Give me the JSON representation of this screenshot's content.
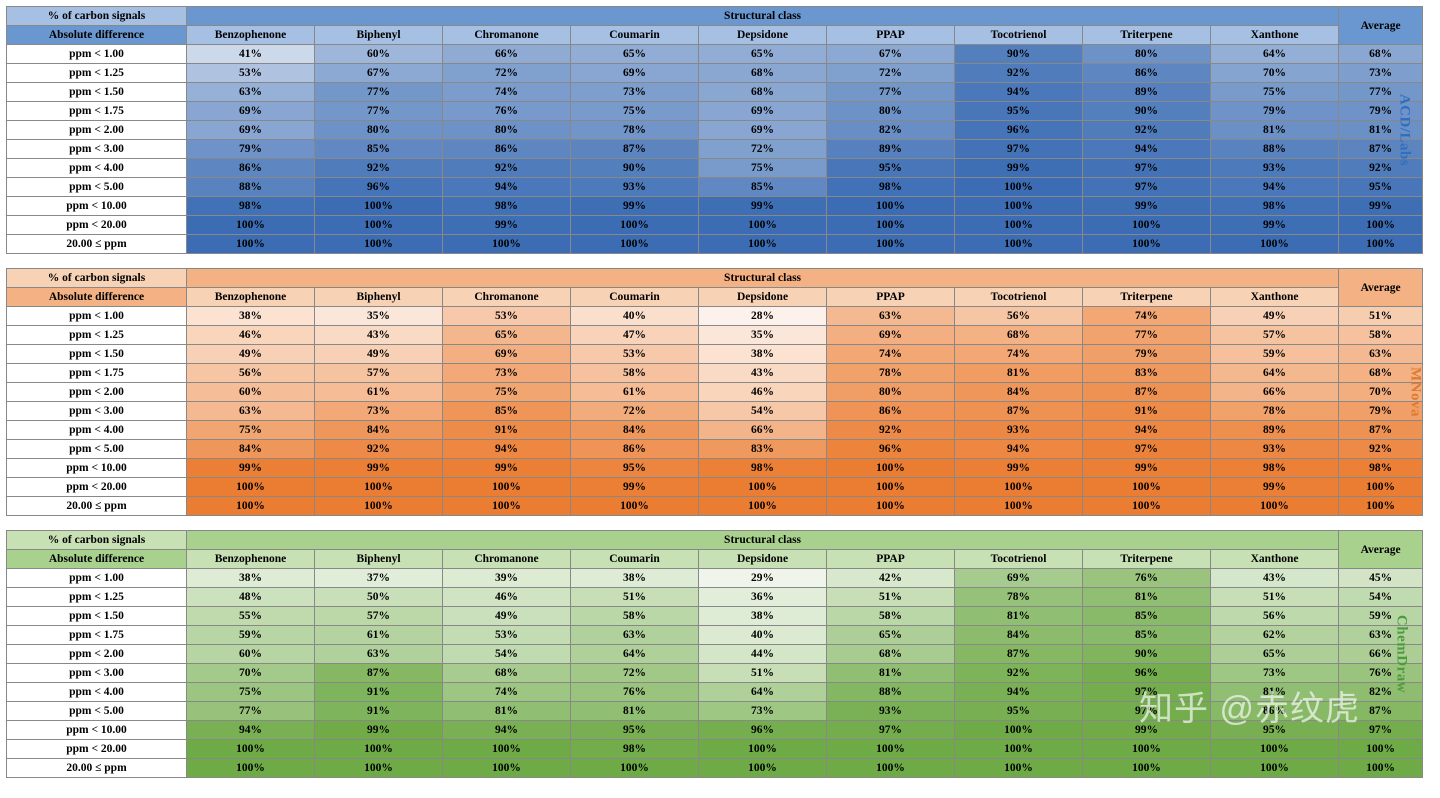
{
  "columns": [
    "Benzophenone",
    "Biphenyl",
    "Chromanone",
    "Coumarin",
    "Depsidone",
    "PPAP",
    "Tocotrienol",
    "Triterpene",
    "Xanthone"
  ],
  "row_labels": [
    "ppm < 1.00",
    "ppm < 1.25",
    "ppm < 1.50",
    "ppm < 1.75",
    "ppm < 2.00",
    "ppm < 3.00",
    "ppm < 4.00",
    "ppm < 5.00",
    "ppm < 10.00",
    "ppm < 20.00",
    "20.00 ≤ ppm"
  ],
  "header_labels": {
    "left_top": "% of carbon signals",
    "left_bottom": "Absolute difference",
    "center": "Structural class",
    "right": "Average"
  },
  "side_labels": [
    "ACD/Labs",
    "MNova",
    "ChemDraw"
  ],
  "watermark": "知乎 @赤纹虎",
  "schemes": [
    {
      "header_bg": [
        "#6a97cf",
        "#a6c0e4",
        "#6a97cf"
      ],
      "base_rgb": [
        60,
        109,
        180
      ],
      "side_class": "side-blue"
    },
    {
      "header_bg": [
        "#f4b183",
        "#f8d2b4",
        "#f4b183"
      ],
      "base_rgb": [
        235,
        125,
        50
      ],
      "side_class": "side-orange"
    },
    {
      "header_bg": [
        "#a9d18e",
        "#c7e0b4",
        "#a9d18e"
      ],
      "base_rgb": [
        110,
        170,
        70
      ],
      "side_class": "side-green"
    }
  ],
  "chart_data": [
    {
      "type": "table",
      "title": "ACD/Labs — % of carbon signals within absolute-difference threshold",
      "row_labels_ref": "row_labels",
      "columns_ref": "columns",
      "average_column": true,
      "unit": "%",
      "values": [
        [
          41,
          60,
          66,
          65,
          65,
          67,
          90,
          80,
          64,
          68
        ],
        [
          53,
          67,
          72,
          69,
          68,
          72,
          92,
          86,
          70,
          73
        ],
        [
          63,
          77,
          74,
          73,
          68,
          77,
          94,
          89,
          75,
          77
        ],
        [
          69,
          77,
          76,
          75,
          69,
          80,
          95,
          90,
          79,
          79
        ],
        [
          69,
          80,
          80,
          78,
          69,
          82,
          96,
          92,
          81,
          81
        ],
        [
          79,
          85,
          86,
          87,
          72,
          89,
          97,
          94,
          88,
          87
        ],
        [
          86,
          92,
          92,
          90,
          75,
          95,
          99,
          97,
          93,
          92
        ],
        [
          88,
          96,
          94,
          93,
          85,
          98,
          100,
          97,
          94,
          95
        ],
        [
          98,
          100,
          98,
          99,
          99,
          100,
          100,
          99,
          98,
          99
        ],
        [
          100,
          100,
          99,
          100,
          100,
          100,
          100,
          100,
          99,
          100
        ],
        [
          100,
          100,
          100,
          100,
          100,
          100,
          100,
          100,
          100,
          100
        ]
      ]
    },
    {
      "type": "table",
      "title": "MNova — % of carbon signals within absolute-difference threshold",
      "row_labels_ref": "row_labels",
      "columns_ref": "columns",
      "average_column": true,
      "unit": "%",
      "values": [
        [
          38,
          35,
          53,
          40,
          28,
          63,
          56,
          74,
          49,
          51
        ],
        [
          46,
          43,
          65,
          47,
          35,
          69,
          68,
          77,
          57,
          58
        ],
        [
          49,
          49,
          69,
          53,
          38,
          74,
          74,
          79,
          59,
          63
        ],
        [
          56,
          57,
          73,
          58,
          43,
          78,
          81,
          83,
          64,
          68
        ],
        [
          60,
          61,
          75,
          61,
          46,
          80,
          84,
          87,
          66,
          70
        ],
        [
          63,
          73,
          85,
          72,
          54,
          86,
          87,
          91,
          78,
          79
        ],
        [
          75,
          84,
          91,
          84,
          66,
          92,
          93,
          94,
          89,
          87
        ],
        [
          84,
          92,
          94,
          86,
          83,
          96,
          94,
          97,
          93,
          92
        ],
        [
          99,
          99,
          99,
          95,
          98,
          100,
          99,
          99,
          98,
          98
        ],
        [
          100,
          100,
          100,
          99,
          100,
          100,
          100,
          100,
          99,
          100
        ],
        [
          100,
          100,
          100,
          100,
          100,
          100,
          100,
          100,
          100,
          100
        ]
      ]
    },
    {
      "type": "table",
      "title": "ChemDraw — % of carbon signals within absolute-difference threshold",
      "row_labels_ref": "row_labels",
      "columns_ref": "columns",
      "average_column": true,
      "unit": "%",
      "values": [
        [
          38,
          37,
          39,
          38,
          29,
          42,
          69,
          76,
          43,
          45
        ],
        [
          48,
          50,
          46,
          51,
          36,
          51,
          78,
          81,
          51,
          54
        ],
        [
          55,
          57,
          49,
          58,
          38,
          58,
          81,
          85,
          56,
          59
        ],
        [
          59,
          61,
          53,
          63,
          40,
          65,
          84,
          85,
          62,
          63
        ],
        [
          60,
          63,
          54,
          64,
          44,
          68,
          87,
          90,
          65,
          66
        ],
        [
          70,
          87,
          68,
          72,
          51,
          81,
          92,
          96,
          73,
          76
        ],
        [
          75,
          91,
          74,
          76,
          64,
          88,
          94,
          97,
          81,
          82
        ],
        [
          77,
          91,
          81,
          81,
          73,
          93,
          95,
          97,
          86,
          87
        ],
        [
          94,
          99,
          94,
          95,
          96,
          97,
          100,
          99,
          95,
          97
        ],
        [
          100,
          100,
          100,
          98,
          100,
          100,
          100,
          100,
          100,
          100
        ],
        [
          100,
          100,
          100,
          100,
          100,
          100,
          100,
          100,
          100,
          100
        ]
      ]
    }
  ]
}
